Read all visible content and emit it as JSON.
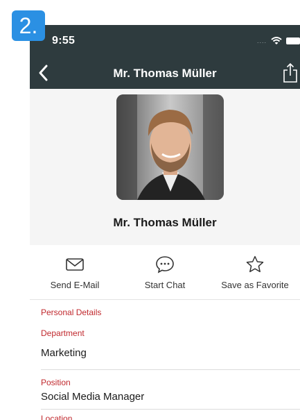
{
  "step_badge": "2.",
  "status_bar": {
    "time": "9:55",
    "signal": "....",
    "icons": [
      "wifi-icon",
      "battery-icon"
    ]
  },
  "nav": {
    "title": "Mr. Thomas Müller",
    "back_icon": "chevron-left-icon",
    "share_icon": "share-icon"
  },
  "profile": {
    "name": "Mr. Thomas Müller"
  },
  "actions": [
    {
      "label": "Send E-Mail",
      "icon": "envelope-icon"
    },
    {
      "label": "Start Chat",
      "icon": "chat-bubble-icon"
    },
    {
      "label": "Save as Favorite",
      "icon": "star-icon"
    }
  ],
  "details": {
    "section_title": "Personal Details",
    "fields": [
      {
        "label": "Department",
        "value": "Marketing"
      },
      {
        "label": "Position",
        "value": "Social Media Manager"
      },
      {
        "label": "Location",
        "value": ""
      }
    ]
  },
  "colors": {
    "bar": "#2e3b3e",
    "accent_red": "#c0282d",
    "badge": "#2b90e3"
  }
}
